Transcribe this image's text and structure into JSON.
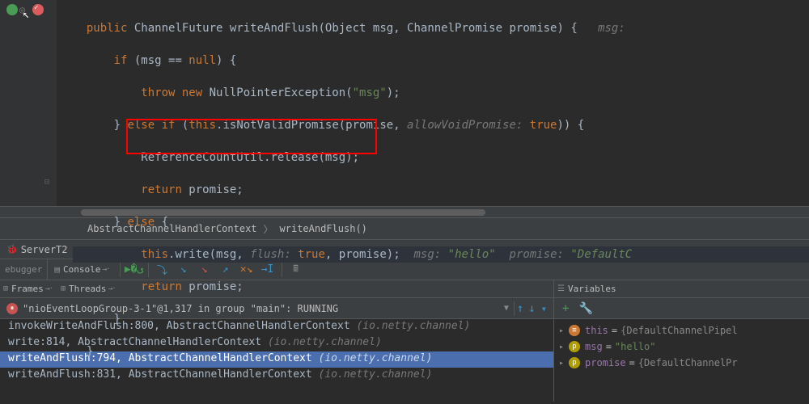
{
  "code": {
    "signature": {
      "kw1": "public",
      "type": "ChannelFuture",
      "name": "writeAndFlush",
      "params": "(Object msg, ChannelPromise promise) {",
      "hint": "msg:"
    },
    "l2": {
      "kw": "if",
      "cond": " (msg == ",
      "kw2": "null",
      "tail": ") {"
    },
    "l3": {
      "kw": "throw new",
      "ex": " NullPointerException(",
      "str": "\"msg\"",
      "tail": ");"
    },
    "l4": {
      "pre": "} ",
      "kw": "else if",
      "mid": " (",
      "kw2": "this",
      "call": ".isNotValidPromise(promise, ",
      "hint": "allowVoidPromise:",
      "val": " true",
      "tail": ")) {"
    },
    "l5": "ReferenceCountUtil.release(msg);",
    "l6": {
      "kw": "return",
      "tail": " promise;"
    },
    "l7": {
      "pre": "} ",
      "kw": "else",
      "tail": " {"
    },
    "l8": {
      "kw": "this",
      "call": ".write(msg, ",
      "hint": "flush:",
      "val": " true",
      "tail": ", promise);",
      "inl1": "msg: ",
      "inl1v": "\"hello\"",
      "inl2": "  promise: ",
      "inl2v": "\"DefaultC"
    },
    "l9": {
      "kw": "return",
      "tail": " promise;"
    },
    "l10": "}",
    "l11": "}"
  },
  "breadcrumb": {
    "a": "AbstractChannelHandlerContext",
    "b": "writeAndFlush()"
  },
  "debugTab": "ServerT2",
  "toolbar": {
    "left": "ebugger",
    "console": "Console",
    "pin": "→‧"
  },
  "framesHeader": {
    "frames": "Frames",
    "threads": "Threads",
    "pin": "→‧"
  },
  "threadLine": {
    "text": "\"nioEventLoopGroup-3-1\"@1,317 in group \"main\": RUNNING"
  },
  "stack": [
    {
      "m": "invokeWriteAndFlush:800, AbstractChannelHandlerContext ",
      "p": "(io.netty.channel)",
      "sel": false
    },
    {
      "m": "write:814, AbstractChannelHandlerContext ",
      "p": "(io.netty.channel)",
      "sel": false
    },
    {
      "m": "writeAndFlush:794, AbstractChannelHandlerContext ",
      "p": "(io.netty.channel)",
      "sel": true
    },
    {
      "m": "writeAndFlush:831, AbstractChannelHandlerContext ",
      "p": "(io.netty.channel)",
      "sel": false
    }
  ],
  "varsHeader": "Variables",
  "vars": [
    {
      "badge": "≡",
      "bc": "vb-orange",
      "name": "this",
      "eq": " = ",
      "val": "{DefaultChannelPipel",
      "obj": true
    },
    {
      "badge": "p",
      "bc": "vb-yellow",
      "name": "msg",
      "eq": " = ",
      "val": "\"hello\"",
      "obj": false
    },
    {
      "badge": "p",
      "bc": "vb-yellow",
      "name": "promise",
      "eq": " = ",
      "val": "{DefaultChannelPr",
      "obj": true
    }
  ]
}
